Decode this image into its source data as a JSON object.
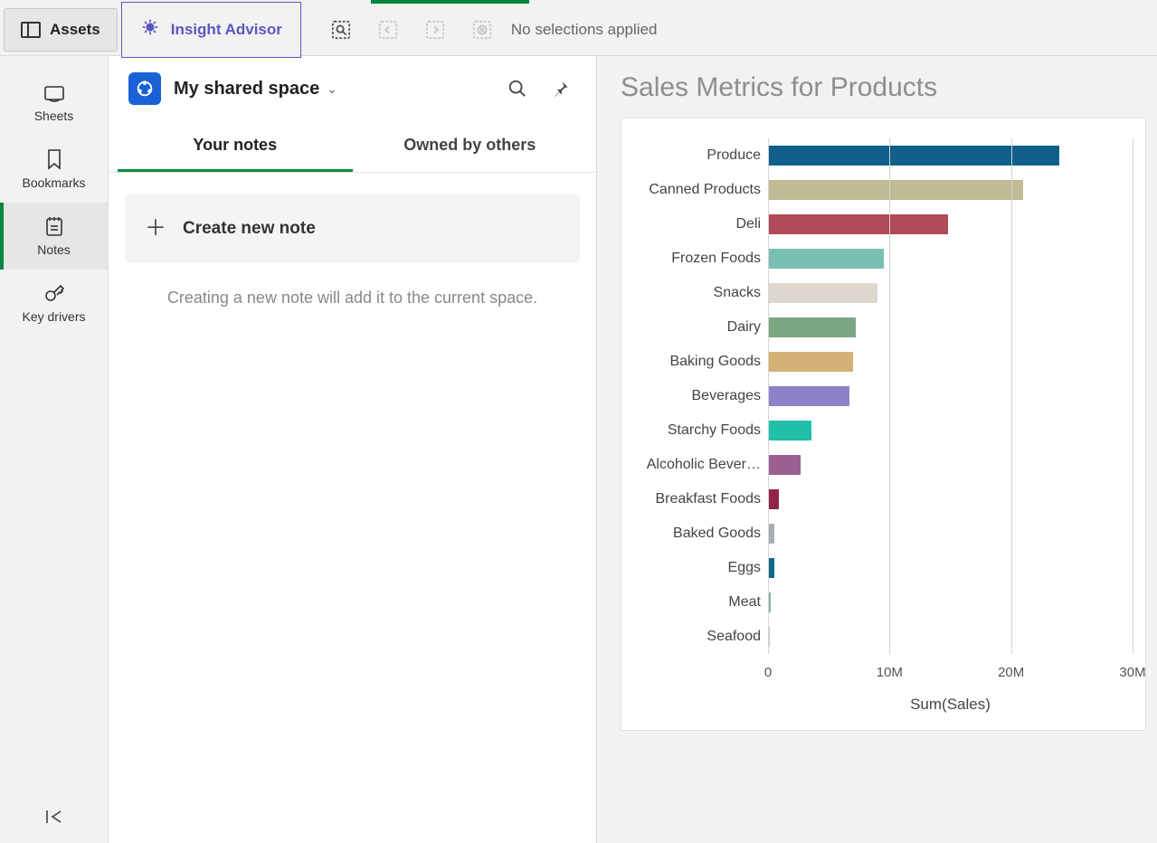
{
  "topbar": {
    "assets_label": "Assets",
    "insight_label": "Insight Advisor",
    "selections_text": "No selections applied"
  },
  "leftnav": {
    "items": [
      {
        "label": "Sheets",
        "icon": "sheets-icon"
      },
      {
        "label": "Bookmarks",
        "icon": "bookmark-icon"
      },
      {
        "label": "Notes",
        "icon": "notes-icon"
      },
      {
        "label": "Key drivers",
        "icon": "keydrivers-icon"
      }
    ]
  },
  "notes_panel": {
    "space_name": "My shared space",
    "tabs": {
      "your_notes": "Your notes",
      "owned_by_others": "Owned by others"
    },
    "create_label": "Create new note",
    "hint": "Creating a new note will add it to the current space."
  },
  "chart_title": "Sales Metrics for Products",
  "chart_data": {
    "type": "bar",
    "orientation": "horizontal",
    "categories": [
      "Produce",
      "Canned Products",
      "Deli",
      "Frozen Foods",
      "Snacks",
      "Dairy",
      "Baking Goods",
      "Beverages",
      "Starchy Foods",
      "Alcoholic Bever…",
      "Breakfast Foods",
      "Baked Goods",
      "Eggs",
      "Meat",
      "Seafood"
    ],
    "values": [
      24000000,
      21000000,
      14800000,
      9500000,
      9000000,
      7200000,
      7000000,
      6700000,
      3600000,
      2700000,
      900000,
      500000,
      500000,
      200000,
      150000
    ],
    "colors": [
      "#116089",
      "#bfbb95",
      "#b0495a",
      "#7ac0b2",
      "#ded7cd",
      "#7ba684",
      "#d6b176",
      "#8b82c8",
      "#20bfa9",
      "#9b5f90",
      "#922449",
      "#a9acb0",
      "#0f6a87",
      "#7fb6a6",
      "#d2cabf"
    ],
    "xlabel": "Sum(Sales)",
    "xlim": [
      0,
      30000000
    ],
    "xticks": [
      0,
      10000000,
      20000000,
      30000000
    ],
    "xtick_labels": [
      "0",
      "10M",
      "20M",
      "30M"
    ]
  }
}
